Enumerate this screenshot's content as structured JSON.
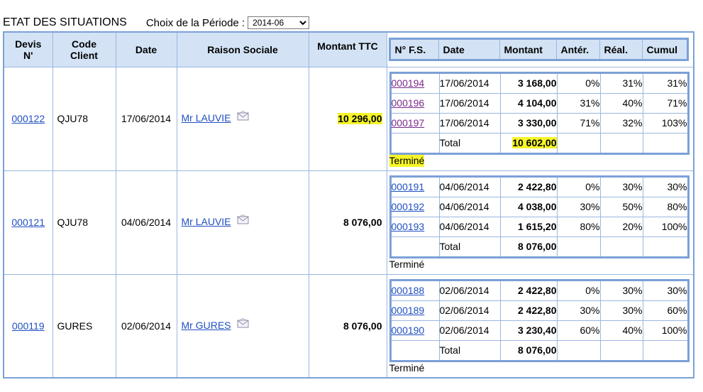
{
  "heading": "ETAT DES SITUATIONS",
  "period": {
    "label": "Choix de la Période :",
    "selected": "2014-06"
  },
  "headers": {
    "devis": "Devis\nN'",
    "code_client": "Code\nClient",
    "date": "Date",
    "raison_sociale": "Raison Sociale",
    "montant_ttc": "Montant TTC"
  },
  "sub_headers": {
    "num": "N° F.S.",
    "date": "Date",
    "montant": "Montant",
    "anter": "Antér.",
    "real": "Réal.",
    "cumul": "Cumul"
  },
  "colors": {
    "border": "#7ba0d8",
    "header_bg": "#d3e3f5",
    "link": "#1f4fc1",
    "visited": "#7b2a8c",
    "highlight": "#f5f52a"
  },
  "rows": [
    {
      "devis": "000122",
      "client": "QJU78",
      "date": "17/06/2014",
      "raison": "Mr LAUVIE",
      "montant": "10 296,00",
      "situations": [
        {
          "num": "000194",
          "date": "17/06/2014",
          "montant": "3 168,00",
          "anter": "0%",
          "real": "31%",
          "cumul": "31%"
        },
        {
          "num": "000196",
          "date": "17/06/2014",
          "montant": "4 104,00",
          "anter": "31%",
          "real": "40%",
          "cumul": "71%"
        },
        {
          "num": "000197",
          "date": "17/06/2014",
          "montant": "3 330,00",
          "anter": "71%",
          "real": "32%",
          "cumul": "103%"
        }
      ],
      "total_label": "Total",
      "total": "10 602,00",
      "status": "Terminé"
    },
    {
      "devis": "000121",
      "client": "QJU78",
      "date": "04/06/2014",
      "raison": "Mr LAUVIE",
      "montant": "8 076,00",
      "situations": [
        {
          "num": "000191",
          "date": "04/06/2014",
          "montant": "2 422,80",
          "anter": "0%",
          "real": "30%",
          "cumul": "30%"
        },
        {
          "num": "000192",
          "date": "04/06/2014",
          "montant": "4 038,00",
          "anter": "30%",
          "real": "50%",
          "cumul": "80%"
        },
        {
          "num": "000193",
          "date": "04/06/2014",
          "montant": "1 615,20",
          "anter": "80%",
          "real": "20%",
          "cumul": "100%"
        }
      ],
      "total_label": "Total",
      "total": "8 076,00",
      "status": "Terminé"
    },
    {
      "devis": "000119",
      "client": "GURES",
      "date": "02/06/2014",
      "raison": "Mr GURES",
      "montant": "8 076,00",
      "situations": [
        {
          "num": "000188",
          "date": "02/06/2014",
          "montant": "2 422,80",
          "anter": "0%",
          "real": "30%",
          "cumul": "30%"
        },
        {
          "num": "000189",
          "date": "02/06/2014",
          "montant": "2 422,80",
          "anter": "30%",
          "real": "30%",
          "cumul": "60%"
        },
        {
          "num": "000190",
          "date": "02/06/2014",
          "montant": "3 230,40",
          "anter": "60%",
          "real": "40%",
          "cumul": "100%"
        }
      ],
      "total_label": "Total",
      "total": "8 076,00",
      "status": "Terminé"
    }
  ]
}
